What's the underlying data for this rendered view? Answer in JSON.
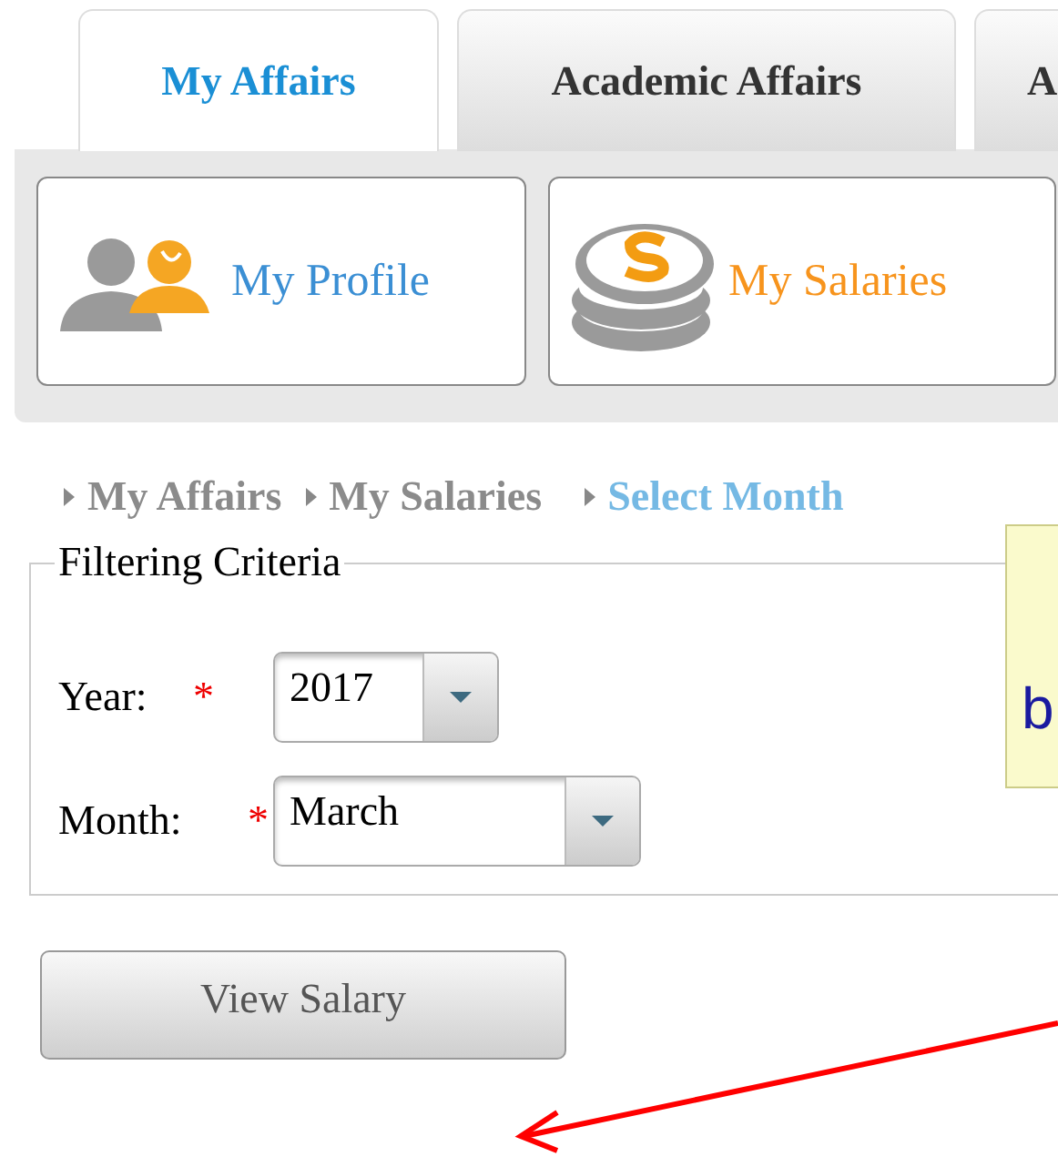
{
  "tabs": [
    {
      "label": "My Affairs",
      "selected": true
    },
    {
      "label": "Academic Affairs",
      "selected": false
    },
    {
      "label": "A",
      "selected": false
    }
  ],
  "tiles": [
    {
      "label": "My Profile",
      "kind": "people",
      "selected": false
    },
    {
      "label": "My Salaries",
      "kind": "coins",
      "selected": true
    }
  ],
  "breadcrumb": [
    {
      "label": "My Affairs",
      "current": false
    },
    {
      "label": "My Salaries",
      "current": false
    },
    {
      "label": "Select Month",
      "current": true
    }
  ],
  "filter": {
    "legend": "Filtering Criteria",
    "fields": [
      {
        "label": "Year:",
        "required_mark": "*",
        "value": "2017",
        "kind": "short"
      },
      {
        "label": "Month:",
        "required_mark": "*",
        "value": "March",
        "kind": "wide"
      }
    ]
  },
  "callout": {
    "text": "b"
  },
  "button": "View Salary"
}
